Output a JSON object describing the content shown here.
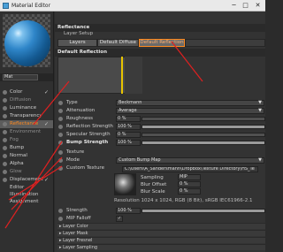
{
  "window": {
    "title": "Material Editor",
    "minimize": "─",
    "maximize": "□",
    "close": "✕"
  },
  "sidebar": {
    "material_name": "Mat",
    "channels": [
      {
        "label": "Color",
        "checked": "✓"
      },
      {
        "label": "Diffusion",
        "checked": ""
      },
      {
        "label": "Luminance",
        "checked": ""
      },
      {
        "label": "Transparency",
        "checked": ""
      },
      {
        "label": "Reflectance",
        "checked": "✓"
      },
      {
        "label": "Environment",
        "checked": ""
      },
      {
        "label": "Fog",
        "checked": ""
      },
      {
        "label": "Bump",
        "checked": ""
      },
      {
        "label": "Normal",
        "checked": ""
      },
      {
        "label": "Alpha",
        "checked": ""
      },
      {
        "label": "Glow",
        "checked": ""
      },
      {
        "label": "Displacement",
        "checked": "✓"
      },
      {
        "label": "Editor",
        "checked": ""
      },
      {
        "label": "Illumination",
        "checked": ""
      },
      {
        "label": "Assignment",
        "checked": ""
      }
    ]
  },
  "main": {
    "section_reflectance": "Reflectance",
    "layer_setup": "Layer Setup",
    "tabs": [
      "Layers",
      "Default Diffuse",
      "Default Reflection"
    ],
    "section_default_reflection": "Default Reflection",
    "props": {
      "type": {
        "label": "Type",
        "value": "Beckmann"
      },
      "attenuation": {
        "label": "Attenuation",
        "value": "Average"
      },
      "roughness": {
        "label": "Roughness",
        "value": "0 %",
        "fill": 0
      },
      "reflection_strength": {
        "label": "Reflection Strength",
        "value": "100 %",
        "fill": 1.0
      },
      "specular_strength": {
        "label": "Specular Strength",
        "value": "0 %",
        "fill": 0
      },
      "bump_strength": {
        "label": "Bump Strength",
        "value": "100 %",
        "fill": 1.0
      },
      "texture": {
        "label": "Texture"
      },
      "mode": {
        "label": "Mode",
        "value": "Custom Bump Map"
      },
      "custom_texture": {
        "label": "Custom Texture",
        "value": "C:\\Users\\A_Sandersmann\\Dropbox\\Texture Directory\\HS_Te"
      },
      "sampling": {
        "label": "Sampling",
        "value": "MIP"
      },
      "blur_offset": {
        "label": "Blur Offset",
        "value": "0 %"
      },
      "blur_scale": {
        "label": "Blur Scale",
        "value": "0 %"
      },
      "resolution": "Resolution 1024 x 1024, RGB (8 Bit), sRGB IEC61966-2.1",
      "strength": {
        "label": "Strength",
        "value": "100 %",
        "fill": 1.0
      },
      "mip_falloff": {
        "label": "MIP Falloff",
        "value": "✓"
      }
    },
    "collapsed_sections": [
      "Layer Color",
      "Layer Mask",
      "Layer Fresnel",
      "Layer Sampling"
    ]
  },
  "colors": {
    "accent": "#ff8a1f",
    "annotation": "#e02020",
    "graph_line": "#e8c400"
  }
}
